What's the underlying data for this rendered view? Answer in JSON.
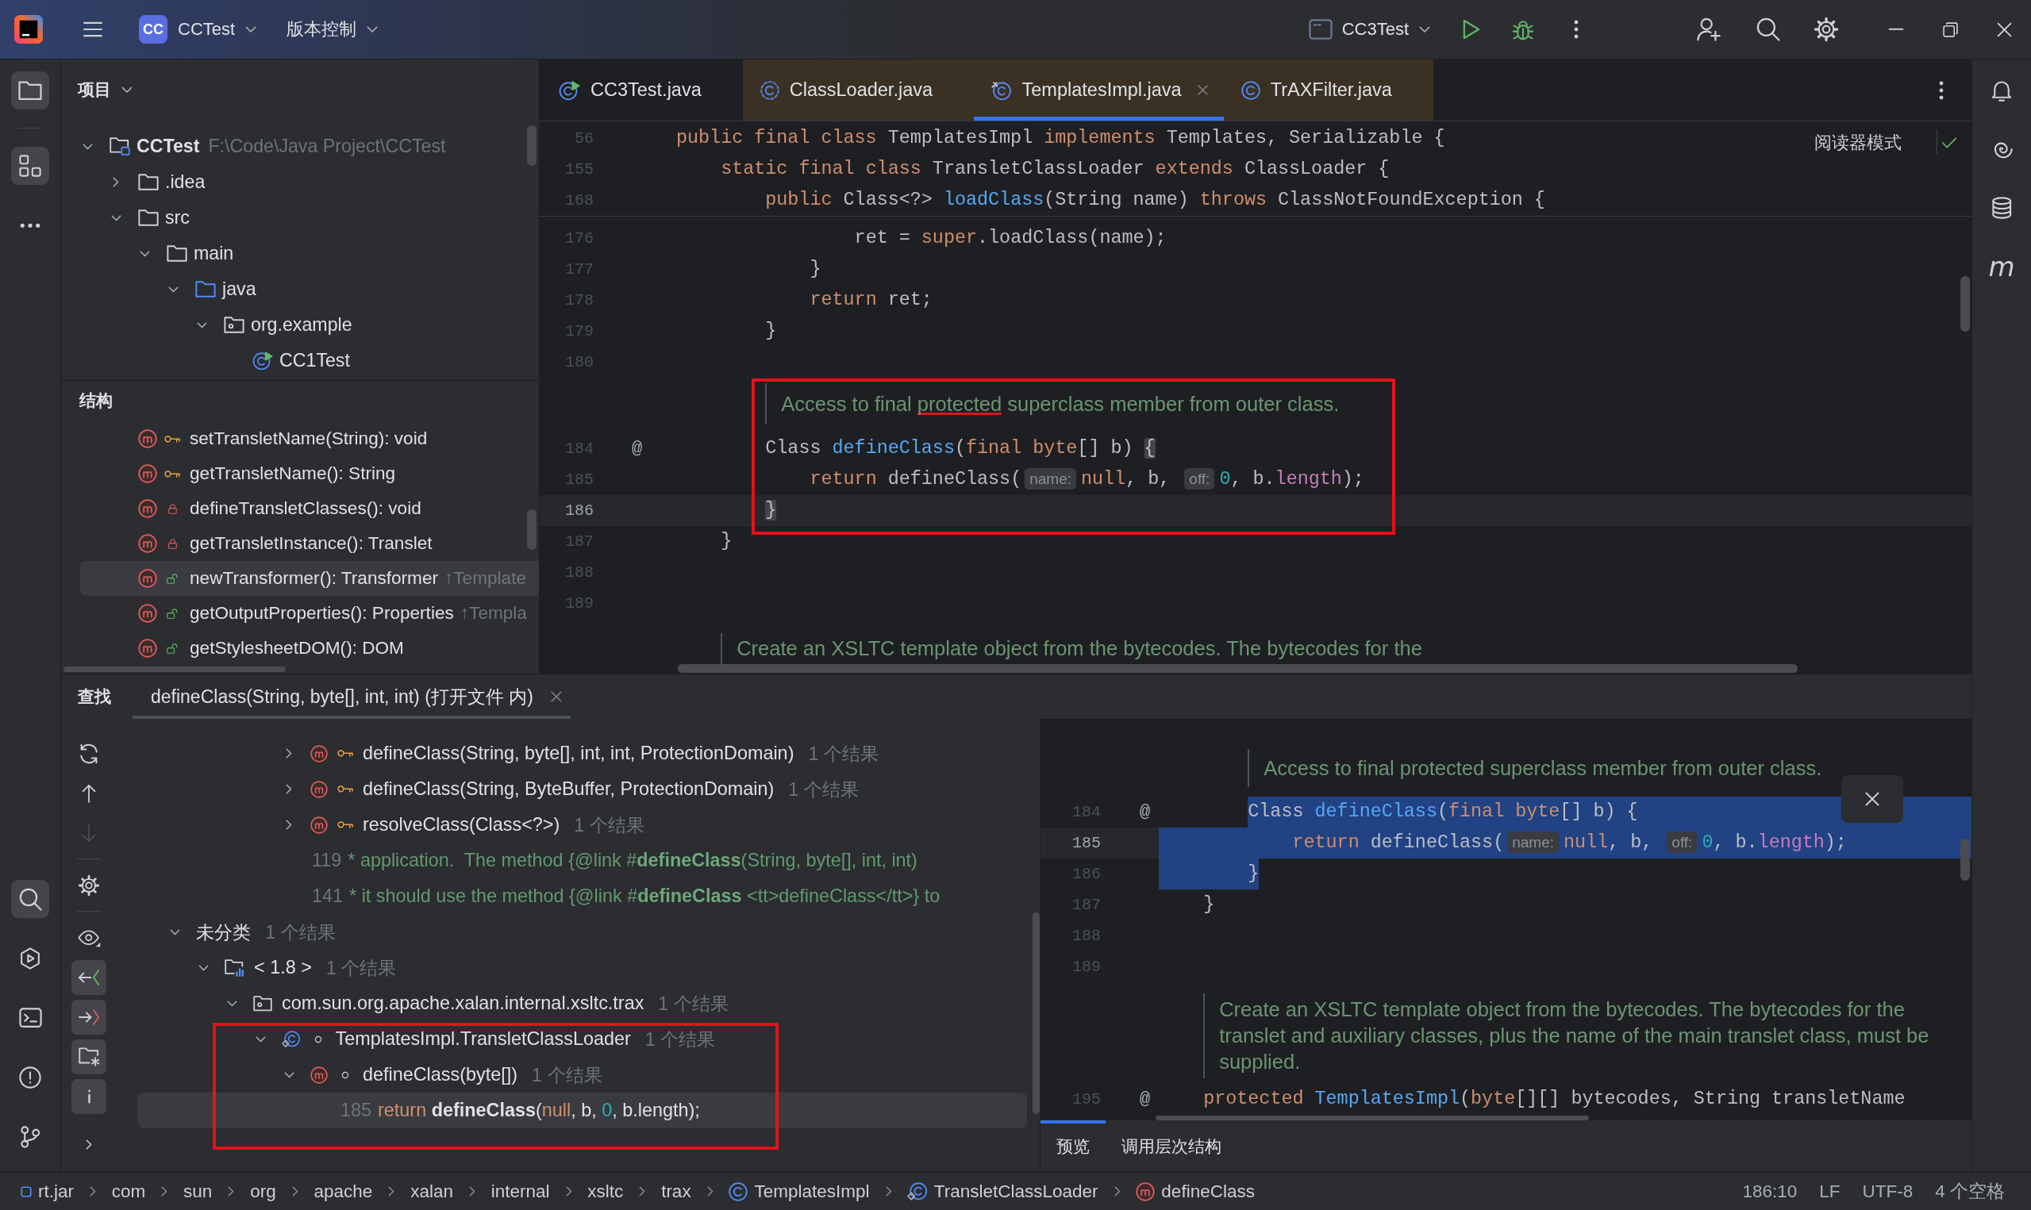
{
  "title_bar": {
    "project_badge": "CC",
    "project": "CCTest",
    "vcs": "版本控制",
    "run_config": "CC3Test"
  },
  "left_strip": {
    "top": [
      {
        "kind": "project",
        "selected": true
      },
      {
        "kind": "structure",
        "selected": true
      },
      {
        "kind": "more",
        "selected": false
      }
    ],
    "bottom": [
      {
        "kind": "find",
        "selected": true
      },
      {
        "kind": "run",
        "selected": false
      },
      {
        "kind": "terminal",
        "selected": false
      },
      {
        "kind": "problems",
        "selected": false
      },
      {
        "kind": "git",
        "selected": false
      }
    ]
  },
  "project_panel": {
    "title": "项目",
    "tree": [
      {
        "kind": "module",
        "label": "CCTest",
        "path": "F:\\Code\\Java Project\\CCTest",
        "expanded": true,
        "children": [
          {
            "kind": "folder",
            "label": ".idea",
            "expanded": false
          },
          {
            "kind": "folder",
            "label": "src",
            "expanded": true,
            "children": [
              {
                "kind": "folder",
                "label": "main",
                "expanded": true,
                "children": [
                  {
                    "kind": "source-root",
                    "label": "java",
                    "expanded": true,
                    "children": [
                      {
                        "kind": "package",
                        "label": "org.example",
                        "expanded": true,
                        "children": [
                          {
                            "kind": "runnable-class",
                            "label": "CC1Test"
                          }
                        ]
                      }
                    ]
                  }
                ]
              }
            ]
          }
        ]
      }
    ]
  },
  "structure_panel": {
    "title": "结构",
    "items": [
      {
        "kind": "protected-method",
        "signature": "setTransletName(String): void",
        "selected": false
      },
      {
        "kind": "protected-method",
        "signature": "getTransletName(): String",
        "selected": false
      },
      {
        "kind": "private-method",
        "signature": "defineTransletClasses(): void",
        "selected": false
      },
      {
        "kind": "private-method",
        "signature": "getTransletInstance(): Translet",
        "selected": false
      },
      {
        "kind": "public-method",
        "signature": "newTransformer(): Transformer",
        "inherited": "↑Template",
        "selected": true
      },
      {
        "kind": "public-method",
        "signature": "getOutputProperties(): Properties",
        "inherited": "↑Templa",
        "selected": false
      },
      {
        "kind": "public-method",
        "signature": "getStylesheetDOM(): DOM",
        "selected": false
      }
    ]
  },
  "editor": {
    "tabs": [
      {
        "kind": "runnable-class",
        "label": "CC3Test.java",
        "library": false,
        "selected": false
      },
      {
        "kind": "abstract-class",
        "label": "ClassLoader.java",
        "library": true,
        "selected": false
      },
      {
        "kind": "final-class",
        "label": "TemplatesImpl.java",
        "library": true,
        "selected": true
      },
      {
        "kind": "class",
        "label": "TrAXFilter.java",
        "library": true,
        "selected": false
      }
    ],
    "reader_mode": "阅读器模式",
    "sticky_lines": [
      {
        "kind": "code",
        "number": "56",
        "tokens": [
          {
            "kind": "keyword",
            "text": "public final class "
          },
          {
            "kind": "plain",
            "text": "TemplatesImpl "
          },
          {
            "kind": "keyword",
            "text": "implements "
          },
          {
            "kind": "plain",
            "text": "Templates, Serializable {"
          }
        ]
      },
      {
        "kind": "code",
        "number": "155",
        "tokens": [
          {
            "kind": "keyword",
            "text": "    static final class "
          },
          {
            "kind": "plain",
            "text": "TransletClassLoader "
          },
          {
            "kind": "keyword",
            "text": "extends "
          },
          {
            "kind": "plain",
            "text": "ClassLoader {"
          }
        ]
      },
      {
        "kind": "code",
        "number": "168",
        "tokens": [
          {
            "kind": "keyword",
            "text": "        public "
          },
          {
            "kind": "plain",
            "text": "Class<?> "
          },
          {
            "kind": "method",
            "text": "loadClass"
          },
          {
            "kind": "plain",
            "text": "(String name) "
          },
          {
            "kind": "keyword",
            "text": "throws "
          },
          {
            "kind": "plain",
            "text": "ClassNotFoundException {"
          }
        ]
      }
    ],
    "lines": [
      {
        "kind": "code",
        "number": "176",
        "current": false,
        "tokens": [
          {
            "kind": "plain",
            "text": "                ret = "
          },
          {
            "kind": "keyword",
            "text": "super"
          },
          {
            "kind": "plain",
            "text": ".loadClass(name);"
          }
        ]
      },
      {
        "kind": "code",
        "number": "177",
        "current": false,
        "tokens": [
          {
            "kind": "plain",
            "text": "            }"
          }
        ]
      },
      {
        "kind": "code",
        "number": "178",
        "current": false,
        "tokens": [
          {
            "kind": "keyword",
            "text": "            return"
          },
          {
            "kind": "plain",
            "text": " ret;"
          }
        ]
      },
      {
        "kind": "code",
        "number": "179",
        "current": false,
        "tokens": [
          {
            "kind": "plain",
            "text": "        }"
          }
        ]
      },
      {
        "kind": "code",
        "number": "180",
        "current": false
      },
      {
        "kind": "annotation",
        "lines": [
          {
            "kind": "doc",
            "parts": [
              {
                "text": "Access to final ",
                "marked": false
              },
              {
                "text": "protected",
                "marked": true
              },
              {
                "text": " superclass member from outer class.",
                "marked": false
              }
            ]
          },
          {
            "kind": "code",
            "number": "184",
            "gutter": "@",
            "current": false,
            "tokens": [
              {
                "kind": "plain",
                "text": "        Class "
              },
              {
                "kind": "method",
                "text": "defineClass"
              },
              {
                "kind": "plain",
                "text": "("
              },
              {
                "kind": "keyword",
                "text": "final byte"
              },
              {
                "kind": "plain",
                "text": "[] b) "
              },
              {
                "kind": "brace",
                "text": "{"
              }
            ]
          },
          {
            "kind": "code",
            "number": "185",
            "current": false,
            "tokens": [
              {
                "kind": "keyword",
                "text": "            return"
              },
              {
                "kind": "plain",
                "text": " defineClass("
              },
              {
                "kind": "hint",
                "text": "name:"
              },
              {
                "kind": "keyword",
                "text": "null"
              },
              {
                "kind": "plain",
                "text": ", b, "
              },
              {
                "kind": "hint",
                "text": "off:"
              },
              {
                "kind": "number",
                "text": "0"
              },
              {
                "kind": "plain",
                "text": ", b."
              },
              {
                "kind": "field",
                "text": "length"
              },
              {
                "kind": "plain",
                "text": ");"
              }
            ]
          },
          {
            "kind": "code",
            "number": "186",
            "current": true,
            "tokens": [
              {
                "kind": "brace",
                "text": "        }"
              }
            ]
          }
        ]
      },
      {
        "kind": "code",
        "number": "187",
        "current": false,
        "tokens": [
          {
            "kind": "plain",
            "text": "    }"
          }
        ]
      },
      {
        "kind": "code",
        "number": "188",
        "current": false
      },
      {
        "kind": "code",
        "number": "189",
        "current": false
      },
      {
        "kind": "doc",
        "parts": [
          {
            "text": "Create an XSLTC template object from the bytecodes. The bytecodes for the",
            "marked": false
          }
        ]
      }
    ]
  },
  "right_strip": [
    {
      "kind": "notifications"
    },
    {
      "kind": "ai"
    },
    {
      "kind": "database"
    },
    {
      "kind": "maven",
      "glyph": "m"
    }
  ],
  "find_panel": {
    "title": "查找",
    "tab": {
      "label": "defineClass(String, byte[], int, int) (打开文件 内)",
      "selected": true
    },
    "toolbar": [
      {
        "kind": "refresh",
        "on": false,
        "disabled": false
      },
      {
        "kind": "previous",
        "on": false,
        "disabled": false
      },
      {
        "kind": "next",
        "on": false,
        "disabled": true
      },
      {
        "kind": "settings",
        "on": false,
        "disabled": false
      },
      {
        "kind": "preview",
        "on": false,
        "disabled": false
      },
      {
        "kind": "read-access",
        "on": true,
        "disabled": false
      },
      {
        "kind": "write-access",
        "on": true,
        "disabled": false
      },
      {
        "kind": "group-by-directory",
        "on": true,
        "disabled": false
      },
      {
        "kind": "info",
        "on": true,
        "disabled": false
      },
      {
        "kind": "expand",
        "on": false,
        "disabled": false
      }
    ],
    "continued": [
      {
        "kind": "protected-method",
        "label": "defineClass(String, byte[], int, int, ProtectionDomain)",
        "count": "1 个结果",
        "expanded": false,
        "selected": false
      },
      {
        "kind": "protected-method",
        "label": "defineClass(String, ByteBuffer, ProtectionDomain)",
        "count": "1 个结果",
        "expanded": false,
        "selected": false
      },
      {
        "kind": "protected-method",
        "label": "resolveClass(Class<?>)",
        "count": "1 个结果",
        "expanded": false,
        "selected": false
      },
      {
        "kind": "usage",
        "line": "119",
        "selected": false,
        "tokens": [
          {
            "kind": "comment",
            "text": "* application.  The method {@link #"
          },
          {
            "kind": "comment-match",
            "text": "defineClass"
          },
          {
            "kind": "comment",
            "text": "(String, byte[], int, int)"
          }
        ]
      },
      {
        "kind": "usage",
        "line": "141",
        "selected": false,
        "tokens": [
          {
            "kind": "comment",
            "text": "* it should use the method {@link #"
          },
          {
            "kind": "comment-match",
            "text": "defineClass"
          },
          {
            "kind": "comment",
            "text": " <tt>defineClass</tt>} to"
          }
        ]
      }
    ],
    "results": [
      {
        "kind": "category",
        "label": "未分类",
        "count": "1 个结果",
        "expanded": true,
        "selected": false,
        "children": [
          {
            "kind": "module",
            "label": "< 1.8 >",
            "count": "1 个结果",
            "expanded": true,
            "selected": false,
            "children": [
              {
                "kind": "package",
                "label": "com.sun.org.apache.xalan.internal.xsltc.trax",
                "count": "1 个结果",
                "expanded": true,
                "selected": false,
                "children": [
                  {
                    "kind": "package-inner-class",
                    "label": "TemplatesImpl.TransletClassLoader",
                    "count": "1 个结果",
                    "expanded": true,
                    "selected": false,
                    "annotated": true,
                    "children": [
                      {
                        "kind": "package-method",
                        "label": "defineClass(byte[])",
                        "count": "1 个结果",
                        "expanded": true,
                        "selected": false,
                        "children": [
                          {
                            "kind": "usage",
                            "line": "185",
                            "selected": true,
                            "tokens": [
                              {
                                "kind": "keyword",
                                "text": "return "
                              },
                              {
                                "kind": "match",
                                "text": "defineClass"
                              },
                              {
                                "kind": "plain",
                                "text": "("
                              },
                              {
                                "kind": "keyword",
                                "text": "null"
                              },
                              {
                                "kind": "plain",
                                "text": ", b, "
                              },
                              {
                                "kind": "number",
                                "text": "0"
                              },
                              {
                                "kind": "plain",
                                "text": ", b.length);"
                              }
                            ]
                          }
                        ]
                      }
                    ]
                  }
                ]
              }
            ]
          }
        ]
      }
    ]
  },
  "preview": {
    "lines": [
      {
        "kind": "doc",
        "parts": [
          {
            "text": "Access to final protected superclass member from outer class.",
            "marked": false
          }
        ]
      },
      {
        "kind": "selection",
        "lines": [
          {
            "kind": "code",
            "number": "184",
            "gutter": "@",
            "current": false,
            "tokens": [
              {
                "kind": "plain",
                "text": "        Class "
              },
              {
                "kind": "method",
                "text": "defineClass"
              },
              {
                "kind": "plain",
                "text": "("
              },
              {
                "kind": "keyword",
                "text": "final byte"
              },
              {
                "kind": "plain",
                "text": "[] b) {"
              }
            ]
          },
          {
            "kind": "code",
            "number": "185",
            "current": true,
            "tokens": [
              {
                "kind": "keyword",
                "text": "            return"
              },
              {
                "kind": "plain",
                "text": " defineClass("
              },
              {
                "kind": "hint",
                "text": "name:"
              },
              {
                "kind": "keyword",
                "text": "null"
              },
              {
                "kind": "plain",
                "text": ", b, "
              },
              {
                "kind": "hint",
                "text": "off:"
              },
              {
                "kind": "number",
                "text": "0"
              },
              {
                "kind": "plain",
                "text": ", b."
              },
              {
                "kind": "field",
                "text": "length"
              },
              {
                "kind": "plain",
                "text": ");"
              }
            ]
          },
          {
            "kind": "code",
            "number": "186",
            "current": false,
            "tokens": [
              {
                "kind": "plain",
                "text": "        }"
              }
            ]
          }
        ]
      },
      {
        "kind": "code",
        "number": "187",
        "current": false,
        "tokens": [
          {
            "kind": "plain",
            "text": "    }"
          }
        ]
      },
      {
        "kind": "code",
        "number": "188",
        "current": false
      },
      {
        "kind": "code",
        "number": "189",
        "current": false
      },
      {
        "kind": "doc",
        "parts": [
          {
            "text": "Create an XSLTC template object from the bytecodes. The bytecodes for the translet and auxiliary classes, plus the name of the main translet class, must be supplied.",
            "marked": false
          }
        ]
      },
      {
        "kind": "code",
        "number": "195",
        "gutter": "@",
        "current": false,
        "tokens": [
          {
            "kind": "keyword",
            "text": "    protected "
          },
          {
            "kind": "method",
            "text": "TemplatesImpl"
          },
          {
            "kind": "plain",
            "text": "("
          },
          {
            "kind": "keyword",
            "text": "byte"
          },
          {
            "kind": "plain",
            "text": "[][] bytecodes, String transletName"
          }
        ]
      }
    ],
    "tabs": [
      {
        "label": "预览",
        "selected": true
      },
      {
        "label": "调用层次结构",
        "selected": false
      }
    ]
  },
  "status_bar": {
    "breadcrumbs": [
      {
        "kind": "jar",
        "label": "rt.jar"
      },
      {
        "kind": "package",
        "label": "com"
      },
      {
        "kind": "package",
        "label": "sun"
      },
      {
        "kind": "package",
        "label": "org"
      },
      {
        "kind": "package",
        "label": "apache"
      },
      {
        "kind": "package",
        "label": "xalan"
      },
      {
        "kind": "package",
        "label": "internal"
      },
      {
        "kind": "package",
        "label": "xsltc"
      },
      {
        "kind": "package",
        "label": "trax"
      },
      {
        "kind": "class",
        "label": "TemplatesImpl"
      },
      {
        "kind": "inner-class",
        "label": "TransletClassLoader"
      },
      {
        "kind": "method",
        "label": "defineClass"
      }
    ],
    "caret_position": "186:10",
    "line_separator": "LF",
    "encoding": "UTF-8",
    "indent": "4 个空格"
  }
}
